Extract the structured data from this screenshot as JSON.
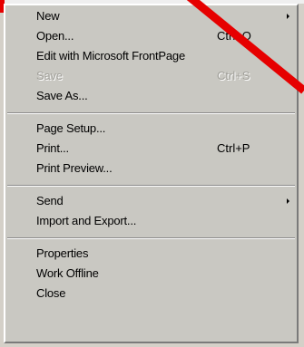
{
  "menu": {
    "items": [
      {
        "label": "New",
        "shortcut": "",
        "submenu": true,
        "disabled": false
      },
      {
        "label": "Open...",
        "shortcut": "Ctrl+O",
        "submenu": false,
        "disabled": false
      },
      {
        "label": "Edit with Microsoft FrontPage",
        "shortcut": "",
        "submenu": false,
        "disabled": false
      },
      {
        "label": "Save",
        "shortcut": "Ctrl+S",
        "submenu": false,
        "disabled": true
      },
      {
        "label": "Save As...",
        "shortcut": "",
        "submenu": false,
        "disabled": false
      },
      {
        "label": "Page Setup...",
        "shortcut": "",
        "submenu": false,
        "disabled": false
      },
      {
        "label": "Print...",
        "shortcut": "Ctrl+P",
        "submenu": false,
        "disabled": false
      },
      {
        "label": "Print Preview...",
        "shortcut": "",
        "submenu": false,
        "disabled": false
      },
      {
        "label": "Send",
        "shortcut": "",
        "submenu": true,
        "disabled": false
      },
      {
        "label": "Import and Export...",
        "shortcut": "",
        "submenu": false,
        "disabled": false
      },
      {
        "label": "Properties",
        "shortcut": "",
        "submenu": false,
        "disabled": false
      },
      {
        "label": "Work Offline",
        "shortcut": "",
        "submenu": false,
        "disabled": false
      },
      {
        "label": "Close",
        "shortcut": "",
        "submenu": false,
        "disabled": false
      }
    ]
  },
  "colors": {
    "menu_background": "#c9c8c2",
    "disabled_text": "#a09f99",
    "annotation_red": "#e60000"
  },
  "icons": {
    "submenu": "submenu-arrow-icon",
    "annotation": "red-slash-mark"
  }
}
